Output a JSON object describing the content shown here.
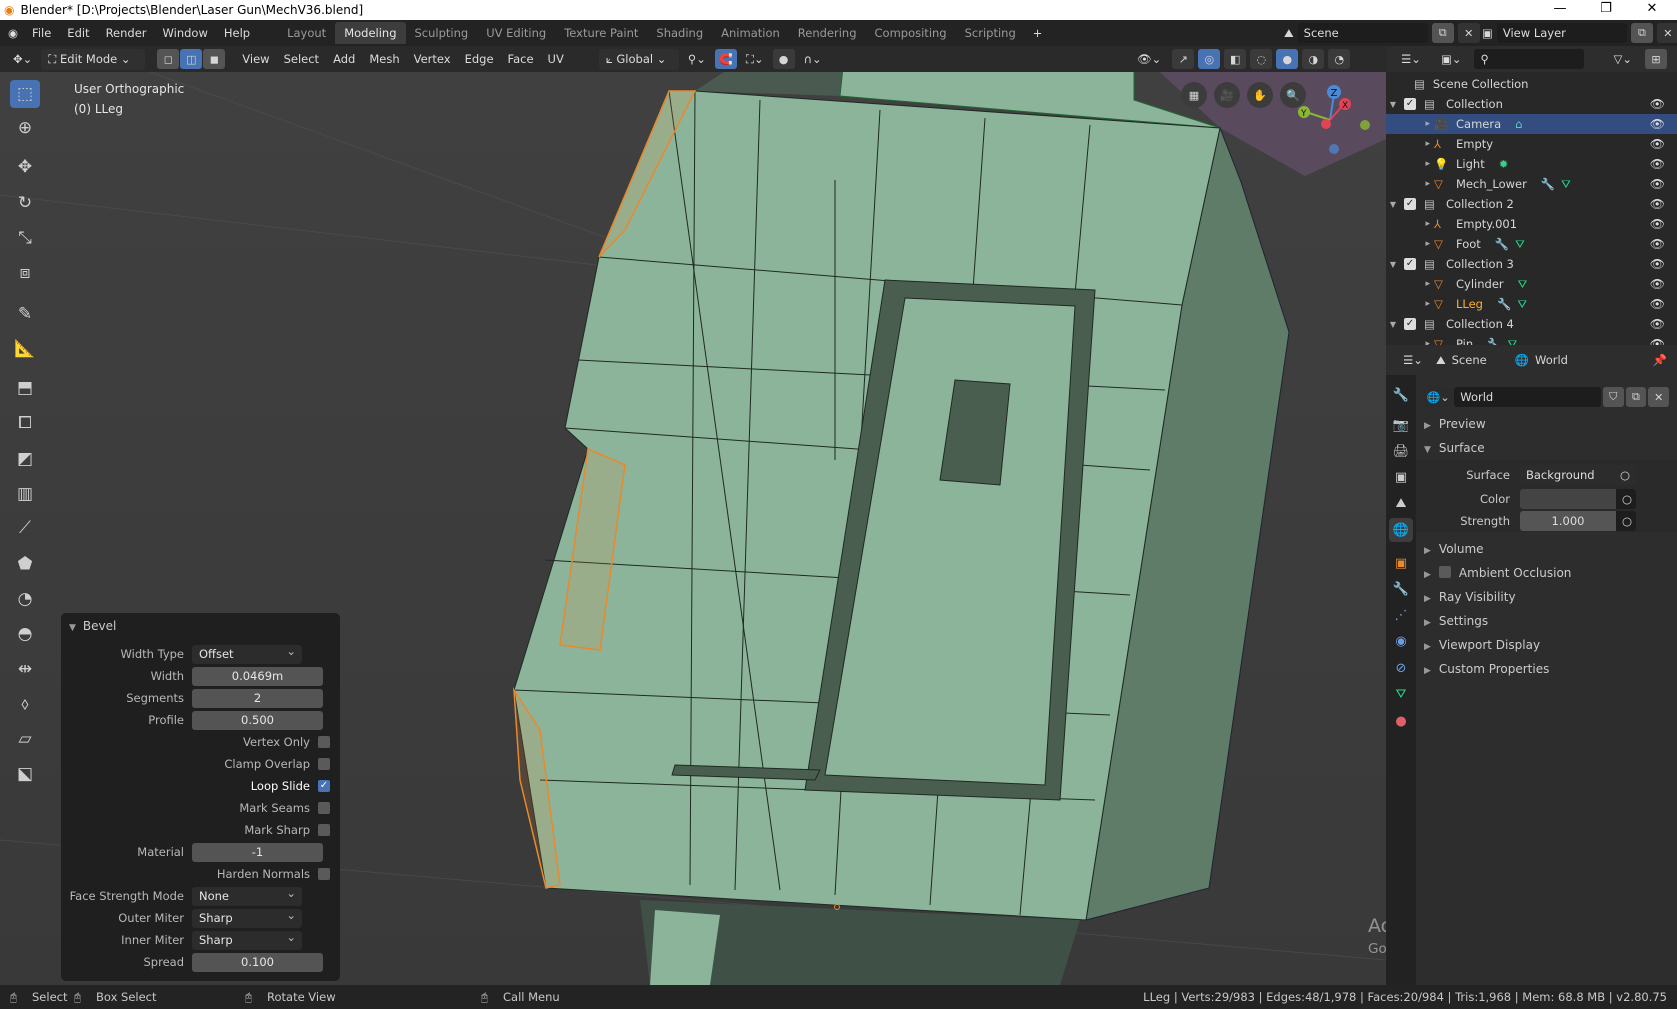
{
  "window": {
    "title": "Blender* [D:\\Projects\\Blender\\Laser Gun\\MechV36.blend]",
    "minimize": "—",
    "maximize": "❐",
    "close": "✕"
  },
  "menu": [
    "File",
    "Edit",
    "Render",
    "Window",
    "Help"
  ],
  "workspaces": [
    {
      "label": "Layout"
    },
    {
      "label": "Modeling",
      "active": true
    },
    {
      "label": "Sculpting"
    },
    {
      "label": "UV Editing"
    },
    {
      "label": "Texture Paint"
    },
    {
      "label": "Shading"
    },
    {
      "label": "Animation"
    },
    {
      "label": "Rendering"
    },
    {
      "label": "Compositing"
    },
    {
      "label": "Scripting"
    }
  ],
  "add_workspace": "+",
  "scene": {
    "name": "Scene",
    "view_layer": "View Layer"
  },
  "viewport_header": {
    "mode": "Edit Mode",
    "menus": [
      "View",
      "Select",
      "Add",
      "Mesh",
      "Vertex",
      "Edge",
      "Face",
      "UV"
    ],
    "transform_orientation": "Global",
    "select_mode": "edge"
  },
  "viewport": {
    "view_name": "User Orthographic",
    "object_label": "(0) LLeg",
    "mesh_color": "#8cb49a",
    "selection_color": "#e8892d",
    "gizmo_axes": [
      "X",
      "Y",
      "Z"
    ]
  },
  "toolbar": [
    "select-box",
    "cursor",
    "move",
    "rotate",
    "scale",
    "transform",
    "annotate",
    "measure",
    "extrude",
    "inset",
    "bevel",
    "loop-cut",
    "knife",
    "poly-build",
    "spin",
    "smooth",
    "edge-slide",
    "shrink-fatten",
    "shear",
    "rip"
  ],
  "bevel": {
    "title": "Bevel",
    "width_type": {
      "label": "Width Type",
      "value": "Offset"
    },
    "width": {
      "label": "Width",
      "value": "0.0469m"
    },
    "segments": {
      "label": "Segments",
      "value": "2"
    },
    "profile": {
      "label": "Profile",
      "value": "0.500"
    },
    "vertex_only": {
      "label": "Vertex Only",
      "checked": false
    },
    "clamp_overlap": {
      "label": "Clamp Overlap",
      "checked": false
    },
    "loop_slide": {
      "label": "Loop Slide",
      "checked": true
    },
    "mark_seams": {
      "label": "Mark Seams",
      "checked": false
    },
    "mark_sharp": {
      "label": "Mark Sharp",
      "checked": false
    },
    "material": {
      "label": "Material",
      "value": "-1"
    },
    "harden_normals": {
      "label": "Harden Normals",
      "checked": false
    },
    "face_strength": {
      "label": "Face Strength Mode",
      "value": "None"
    },
    "outer_miter": {
      "label": "Outer Miter",
      "value": "Sharp"
    },
    "inner_miter": {
      "label": "Inner Miter",
      "value": "Sharp"
    },
    "spread": {
      "label": "Spread",
      "value": "0.100"
    }
  },
  "outliner": {
    "root": "Scene Collection",
    "rows": [
      {
        "label": "Collection",
        "type": "collection",
        "depth": 1,
        "expanded": true
      },
      {
        "label": "Camera",
        "type": "camera",
        "depth": 2,
        "selected": true,
        "extras": [
          "camera-data"
        ]
      },
      {
        "label": "Empty",
        "type": "empty",
        "depth": 2,
        "extras": []
      },
      {
        "label": "Light",
        "type": "light",
        "depth": 2,
        "extras": [
          "light-data"
        ]
      },
      {
        "label": "Mech_Lower",
        "type": "mesh",
        "depth": 2,
        "extras": [
          "modifier",
          "mesh-data"
        ]
      },
      {
        "label": "Collection 2",
        "type": "collection",
        "depth": 1,
        "expanded": true
      },
      {
        "label": "Empty.001",
        "type": "empty",
        "depth": 2,
        "extras": []
      },
      {
        "label": "Foot",
        "type": "mesh",
        "depth": 2,
        "extras": [
          "modifier",
          "mesh-data"
        ]
      },
      {
        "label": "Collection 3",
        "type": "collection",
        "depth": 1,
        "expanded": true
      },
      {
        "label": "Cylinder",
        "type": "mesh",
        "depth": 2,
        "extras": [
          "mesh-data"
        ]
      },
      {
        "label": "LLeg",
        "type": "mesh",
        "depth": 2,
        "active": true,
        "extras": [
          "modifier",
          "mesh-data"
        ]
      },
      {
        "label": "Collection 4",
        "type": "collection",
        "depth": 1,
        "expanded": true
      },
      {
        "label": "Pin",
        "type": "mesh",
        "depth": 2,
        "extras": [
          "modifier",
          "mesh-data"
        ]
      }
    ]
  },
  "properties": {
    "breadcrumb": [
      "Scene",
      "World"
    ],
    "datablock": "World",
    "sections": {
      "preview": "Preview",
      "surface": "Surface",
      "volume": "Volume",
      "ao": "Ambient Occlusion",
      "ray": "Ray Visibility",
      "settings": "Settings",
      "viewport_display": "Viewport Display",
      "custom": "Custom Properties"
    },
    "surface": {
      "label": "Surface",
      "value": "Background"
    },
    "color": {
      "label": "Color",
      "value": "#444444"
    },
    "strength": {
      "label": "Strength",
      "value": "1.000"
    }
  },
  "status": {
    "select": "Select",
    "box_select": "Box Select",
    "rotate": "Rotate View",
    "menu": "Call Menu",
    "stats": "LLeg | Verts:29/983 | Edges:48/1,978 | Faces:20/984 | Tris:1,968 | Mem: 68.8 MB | v2.80.75"
  },
  "watermark": {
    "title": "Activate Windows",
    "subtitle": "Go to Settings to activate Windows."
  }
}
